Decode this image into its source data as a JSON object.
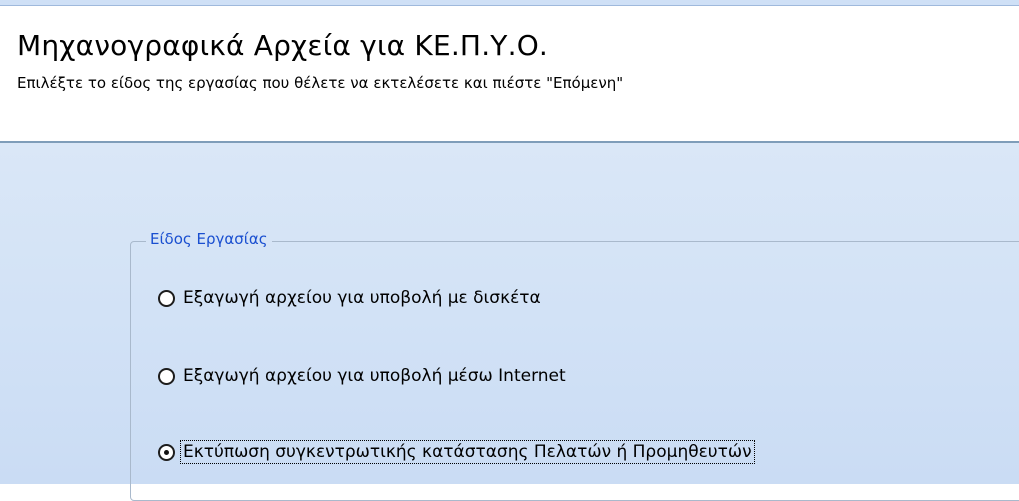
{
  "header": {
    "title": "Μηχανογραφικά Αρχεία για ΚΕ.Π.Υ.Ο.",
    "subtitle": "Επιλέξτε το είδος της εργασίας που θέλετε να εκτελέσετε και πιέστε \"Επόμενη\""
  },
  "task_group": {
    "legend": "Είδος Εργασίας",
    "options": [
      {
        "label": "Εξαγωγή αρχείου για υποβολή με δισκέτα",
        "selected": false
      },
      {
        "label": "Εξαγωγή αρχείου για υποβολή μέσω Internet",
        "selected": false
      },
      {
        "label": "Εκτύπωση συγκεντρωτικής κατάστασης Πελατών ή Προμηθευτών",
        "selected": true
      }
    ]
  },
  "colors": {
    "legend_text": "#1a4fd0",
    "body_background": "#d2e2f6",
    "separator": "#7f9db9"
  }
}
